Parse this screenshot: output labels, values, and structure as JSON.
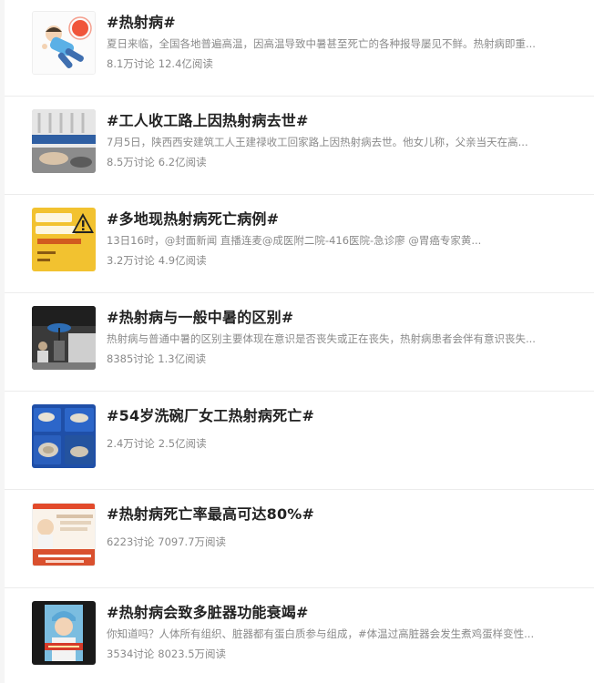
{
  "topics": [
    {
      "title": "#热射病#",
      "description": "夏日来临，全国各地普遍高温，因高温导致中暑甚至死亡的各种报导屡见不鲜。热射病即重...",
      "discussions": "8.1万讨论",
      "reads": "12.4亿阅读",
      "thumb_icon": "heatstroke-illustration-icon"
    },
    {
      "title": "#工人收工路上因热射病去世#",
      "description": "7月5日，陕西西安建筑工人王建禄收工回家路上因热射病去世。他女儿称，父亲当天在高...",
      "discussions": "8.5万讨论",
      "reads": "6.2亿阅读",
      "thumb_icon": "street-photo-icon"
    },
    {
      "title": "#多地现热射病死亡病例#",
      "description": "13日16时，@封面新闻 直播连麦@成医附二院-416医院-急诊廖 @胃癌专家黄...",
      "discussions": "3.2万讨论",
      "reads": "4.9亿阅读",
      "thumb_icon": "warning-poster-icon"
    },
    {
      "title": "#热射病与一般中暑的区别#",
      "description": "热射病与普通中暑的区别主要体现在意识是否丧失或正在丧失，热射病患者会伴有意识丧失...",
      "discussions": "8385讨论",
      "reads": "1.3亿阅读",
      "thumb_icon": "sunny-street-photo-icon"
    },
    {
      "title": "#54岁洗碗厂女工热射病死亡#",
      "description": "",
      "discussions": "2.4万讨论",
      "reads": "2.5亿阅读",
      "thumb_icon": "dish-bins-photo-icon"
    },
    {
      "title": "#热射病死亡率最高可达80%#",
      "description": "",
      "discussions": "6223讨论",
      "reads": "7097.7万阅读",
      "thumb_icon": "news-screenshot-icon"
    },
    {
      "title": "#热射病会致多脏器功能衰竭#",
      "description": "你知道吗？人体所有组织、脏器都有蛋白质参与组成，#体温过高脏器会发生煮鸡蛋样变性...",
      "discussions": "3534讨论",
      "reads": "8023.5万阅读",
      "thumb_icon": "doctor-video-icon"
    }
  ],
  "colors": {
    "title": "#222222",
    "meta": "#8a8a8a",
    "divider": "#ececec"
  }
}
